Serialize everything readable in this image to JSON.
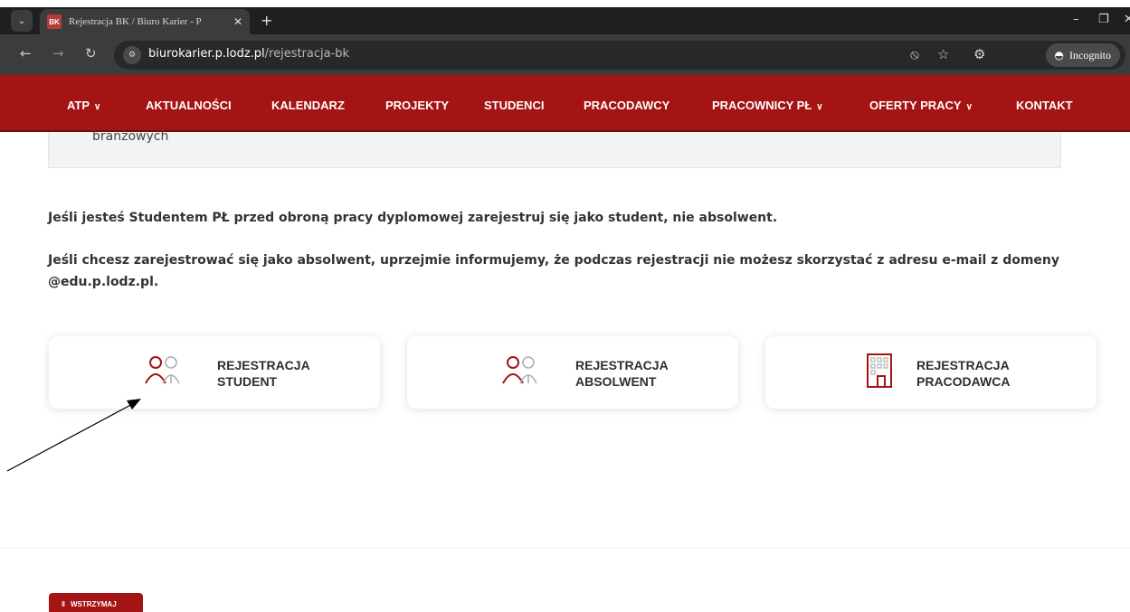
{
  "browser": {
    "tab_title": "Rejestracja BK / Biuro Karier - P",
    "favicon_text": "BK",
    "url_host": "biurokarier.p.lodz.pl",
    "url_path": "/rejestracja-bk",
    "incognito_label": "Incognito"
  },
  "nav": {
    "items": [
      {
        "label": "ATP",
        "dropdown": true
      },
      {
        "label": "AKTUALNOŚCI",
        "dropdown": false
      },
      {
        "label": "KALENDARZ",
        "dropdown": false
      },
      {
        "label": "PROJEKTY",
        "dropdown": false
      },
      {
        "label": "STUDENCI",
        "dropdown": false
      },
      {
        "label": "PRACODAWCY",
        "dropdown": false
      },
      {
        "label": "PRACOWNICY PŁ",
        "dropdown": true
      },
      {
        "label": "OFERTY PRACY",
        "dropdown": true
      },
      {
        "label": "KONTAKT",
        "dropdown": false
      }
    ]
  },
  "content": {
    "info_box_text": "branżowych",
    "para1": "Jeśli jesteś Studentem PŁ przed obroną pracy dyplomowej zarejestruj się jako student, nie absolwent.",
    "para2": "Jeśli chcesz zarejestrować się jako absolwent, uprzejmie informujemy, że podczas rejestracji nie możesz skorzystać z adresu e-mail z domeny @edu.p.lodz.pl."
  },
  "cards": [
    {
      "line1": "REJESTRACJA",
      "line2": "STUDENT",
      "icon": "users-icon"
    },
    {
      "line1": "REJESTRACJA",
      "line2": "ABSOLWENT",
      "icon": "users-icon"
    },
    {
      "line1": "REJESTRACJA",
      "line2": "PRACODAWCA",
      "icon": "building-icon"
    }
  ],
  "footer": {
    "pause_label": "WSTRZYMAJ"
  },
  "colors": {
    "brand_red": "#a41414",
    "icon_gray": "#b0b0b0"
  }
}
